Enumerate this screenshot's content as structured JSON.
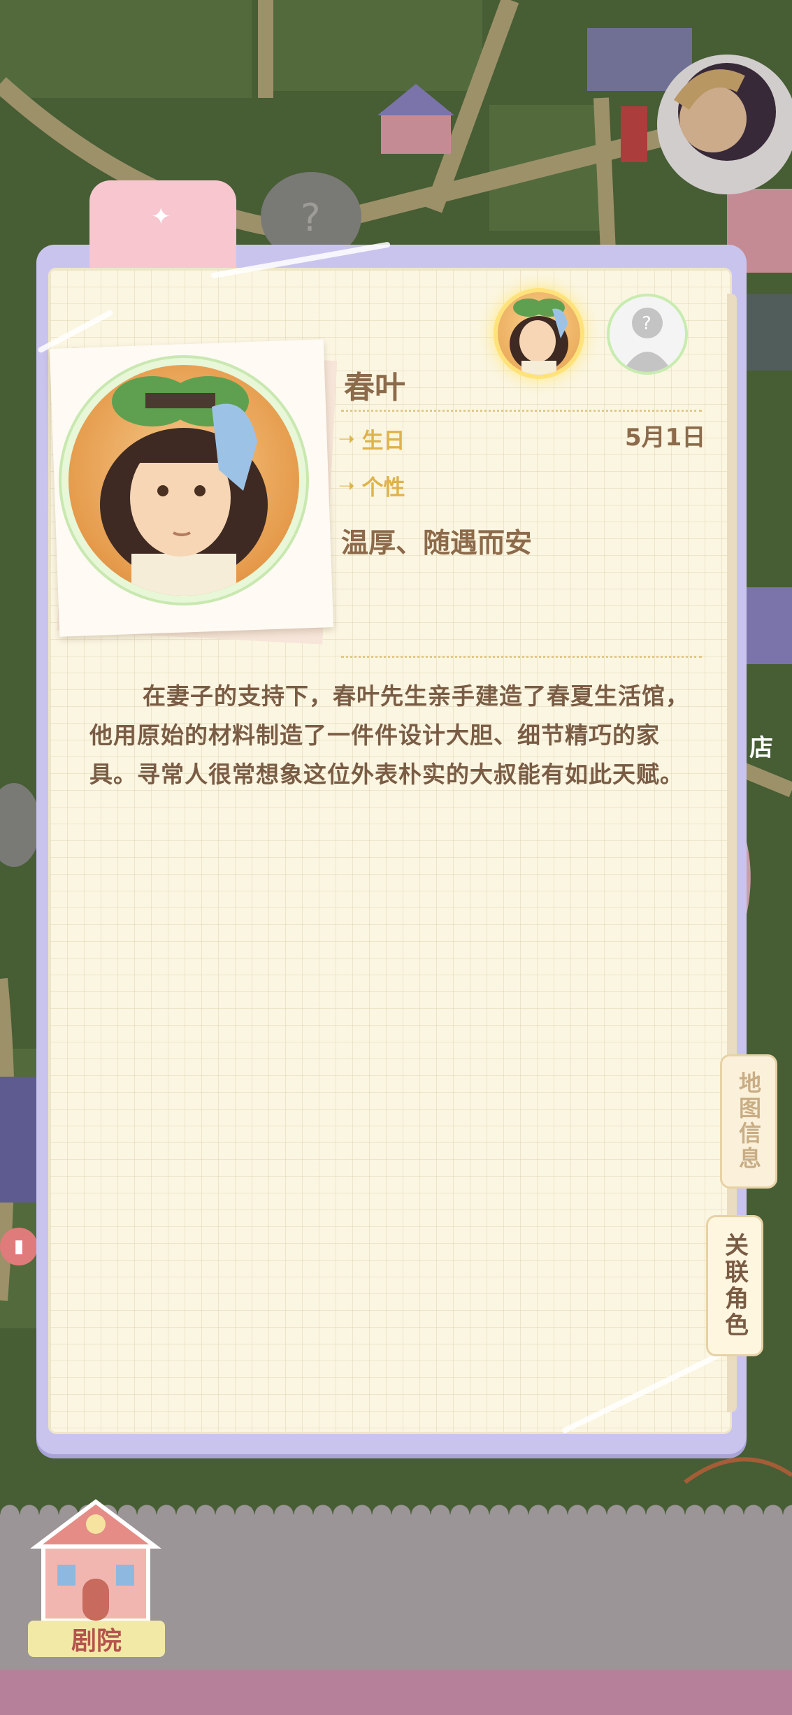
{
  "character": {
    "name": "春叶",
    "birthday_label": "生日",
    "birthday_value": "5月1日",
    "personality_label": "个性",
    "personality_value": "温厚、随遇而安",
    "bio": "在妻子的支持下，春叶先生亲手建造了春夏生活馆，他用原始的材料制造了一件件设计大胆、细节精巧的家具。寻常人很常想象这位外表朴实的大叔能有如此天赋。"
  },
  "side_tabs": {
    "map_info": "地图信息",
    "related_characters": "关联角色"
  },
  "bottom_nav": {
    "theater_label": "剧院"
  },
  "map": {
    "shop_sign": "店"
  },
  "avatars": {
    "unknown_symbol": "?"
  },
  "colors": {
    "frame": "#c9c4ee",
    "paper": "#fbf6e2",
    "label_gold": "#e0b24a",
    "text_brown": "#8c6a4a"
  }
}
